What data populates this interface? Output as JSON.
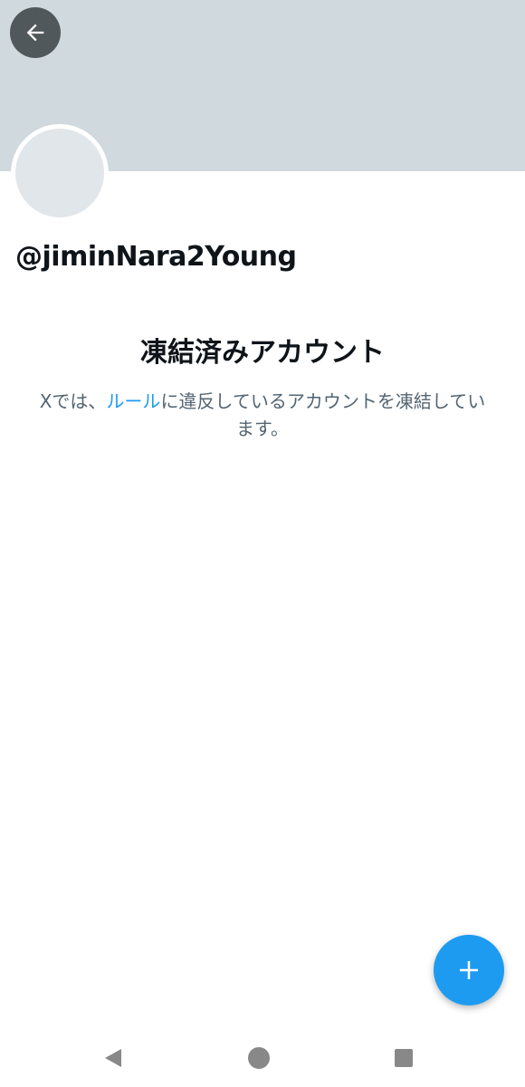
{
  "header": {
    "back_icon": "arrow-left-icon"
  },
  "profile": {
    "handle": "@jiminNara2Young"
  },
  "suspended": {
    "title": "凍結済みアカウント",
    "description_prefix": "Xでは、",
    "rules_link": "ルール",
    "description_suffix": "に違反しているアカウントを凍結しています。"
  },
  "fab": {
    "icon": "plus-icon"
  },
  "system_nav": {
    "back_icon": "triangle-back-icon",
    "home_icon": "circle-home-icon",
    "recents_icon": "square-recents-icon"
  },
  "colors": {
    "banner": "#cfd9de",
    "accent": "#1d9bf0",
    "secondary_text": "#536471"
  }
}
